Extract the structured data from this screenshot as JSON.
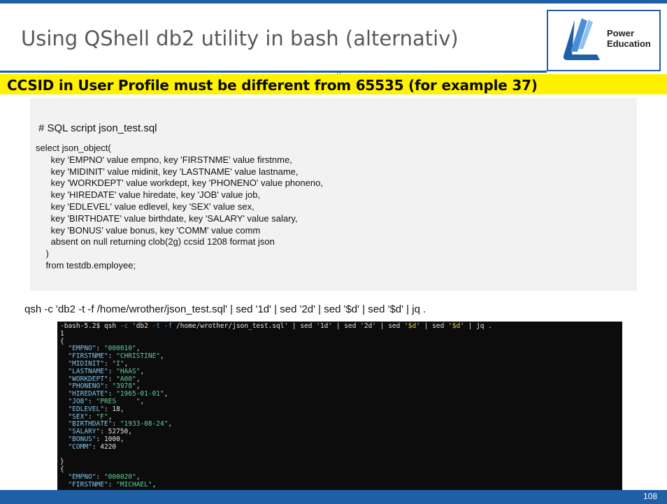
{
  "slide": {
    "title": "Using QShell db2 utility in bash (alternativ)",
    "rule_mark": "0",
    "logo_line1": "Power",
    "logo_line2": "Education",
    "banner": "CCSID in User Profile must be different from 65535 (for example 37)",
    "page_number": "108"
  },
  "code": {
    "comment": "# SQL script json_test.sql",
    "lines": [
      "select json_object(",
      "      key 'EMPNO' value empno, key 'FIRSTNME' value firstnme,",
      "      key 'MIDINIT' value midinit, key 'LASTNAME' value lastname,",
      "      key 'WORKDEPT' value workdept, key 'PHONENO' value phoneno,",
      "      key 'HIREDATE' value hiredate, key 'JOB' value job,",
      "      key 'EDLEVEL' value edlevel, key 'SEX' value sex,",
      "      key 'BIRTHDATE' value birthdate, key 'SALARY' value salary,",
      "      key 'BONUS' value bonus, key 'COMM' value comm",
      "      absent on null returning clob(2g) ccsid 1208 format json",
      "    )",
      "    from testdb.employee;"
    ]
  },
  "command_line": "qsh -c 'db2 -t -f /home/wrother/json_test.sql' | sed '1d' | sed '2d' | sed '$d' | sed '$d' | jq .",
  "terminal": {
    "prompt": "-bash-5.2$",
    "cmd_qsh": "qsh",
    "opt_c": "-c",
    "cmd_quoted_a": "'db2",
    "opt_t": "-t",
    "opt_f": "-f",
    "cmd_path": "/home/wrother/json_test.sql'",
    "pipe1": "| sed '1d' | sed '2d' | sed '",
    "dollar1": "$d",
    "pipe2": "' | sed '",
    "dollar2": "$d",
    "pipe3": "' | jq .",
    "line_one": "1",
    "brace_open": "{",
    "brace_close": "}",
    "record1": [
      {
        "key": "\"EMPNO\"",
        "val": "\"000010\"",
        "kind": "s",
        "tail": ","
      },
      {
        "key": "\"FIRSTNME\"",
        "val": "\"CHRISTINE\"",
        "kind": "s",
        "tail": ","
      },
      {
        "key": "\"MIDINIT\"",
        "val": "\"I\"",
        "kind": "s",
        "tail": ","
      },
      {
        "key": "\"LASTNAME\"",
        "val": "\"HAAS\"",
        "kind": "s",
        "tail": ","
      },
      {
        "key": "\"WORKDEPT\"",
        "val": "\"A00\"",
        "kind": "s",
        "tail": ","
      },
      {
        "key": "\"PHONENO\"",
        "val": "\"3978\"",
        "kind": "s",
        "tail": ","
      },
      {
        "key": "\"HIREDATE\"",
        "val": "\"1965-01-01\"",
        "kind": "s",
        "tail": ","
      },
      {
        "key": "\"JOB\"",
        "val": "\"PRES     \"",
        "kind": "s",
        "tail": ","
      },
      {
        "key": "\"EDLEVEL\"",
        "val": "18",
        "kind": "n",
        "tail": ","
      },
      {
        "key": "\"SEX\"",
        "val": "\"F\"",
        "kind": "s",
        "tail": ","
      },
      {
        "key": "\"BIRTHDATE\"",
        "val": "\"1933-08-24\"",
        "kind": "s",
        "tail": ","
      },
      {
        "key": "\"SALARY\"",
        "val": "52750",
        "kind": "n",
        "tail": ","
      },
      {
        "key": "\"BONUS\"",
        "val": "1000",
        "kind": "n",
        "tail": ","
      },
      {
        "key": "\"COMM\"",
        "val": "4220",
        "kind": "n",
        "tail": ""
      }
    ],
    "record2": [
      {
        "key": "\"EMPNO\"",
        "val": "\"000020\"",
        "kind": "s",
        "tail": ","
      },
      {
        "key": "\"FIRSTNME\"",
        "val": "\"MICHAEL\"",
        "kind": "s",
        "tail": ","
      }
    ]
  },
  "colors": {
    "accent": "#1f5fa6",
    "banner": "#fff100",
    "terminal_bg": "#0c0c0c",
    "json_key": "#7cc6f2",
    "json_string": "#5fd19b"
  }
}
